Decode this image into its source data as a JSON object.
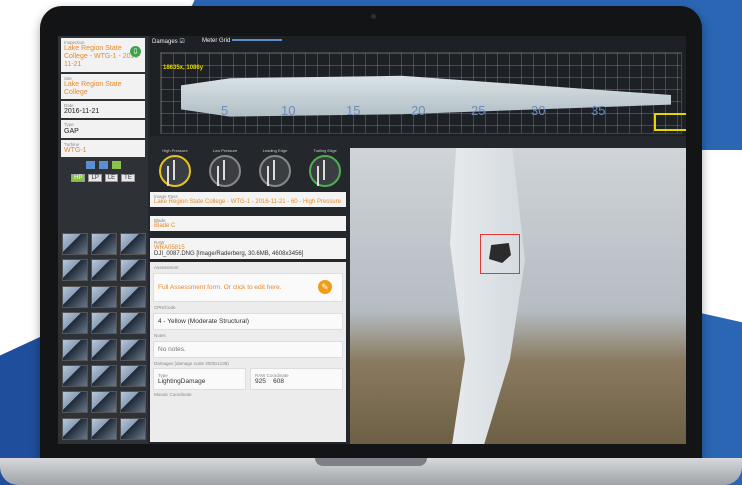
{
  "sidebar": {
    "inspection_label": "Inspection",
    "inspection_value": "Lake Region State College - WTG-1 - 2016-11-21",
    "site_label": "Site",
    "site_value": "Lake Region State College",
    "date_label": "Date",
    "date_value": "2016-11-21",
    "type_label": "Type",
    "type_value": "GAP",
    "turbine_label": "Turbine",
    "turbine_value": "WTG-1",
    "views": [
      "HP",
      "LP",
      "LE",
      "TE"
    ]
  },
  "topbar": {
    "damages_label": "Damages",
    "meter_grid_label": "Meter Grid",
    "coordinate": "18635x, 1086y",
    "ticks": [
      "5",
      "10",
      "15",
      "20",
      "25",
      "30",
      "35"
    ]
  },
  "gauges": [
    "High Pressure",
    "Low Pressure",
    "Leading Edge",
    "Trailing Edge"
  ],
  "cards": {
    "image_pass_label": "Image Pass",
    "image_pass_value": "Lake Region State College - WTG-1 - 2016-11-21 - 60 - High Pressure",
    "blade_label": "Blade",
    "blade_value": "Blade C",
    "raw_label": "RAW",
    "raw_value_1": "WRA05815",
    "raw_value_2": "DJI_0087.DNG [Image/Raderberg, 30.6MB, 4608x3456]"
  },
  "assessment": {
    "assessment_label": "Assessment",
    "full_assessment": "Full Assessment form. Or click to edit here.",
    "cpn_label": "CPN/Code",
    "cpn_value": "4 - Yellow (Moderate Structural)",
    "notes_label": "Notes",
    "notes_value": "No notes.",
    "damages_label": "Damages (damage scale 3000x1138)",
    "type_label": "Type",
    "type_value": "LightingDamage",
    "raw_coord_label": "RAW Coordinate",
    "raw_coord_x": "925",
    "raw_coord_y": "608",
    "mosaic_label": "Mosaic Coordinate"
  }
}
